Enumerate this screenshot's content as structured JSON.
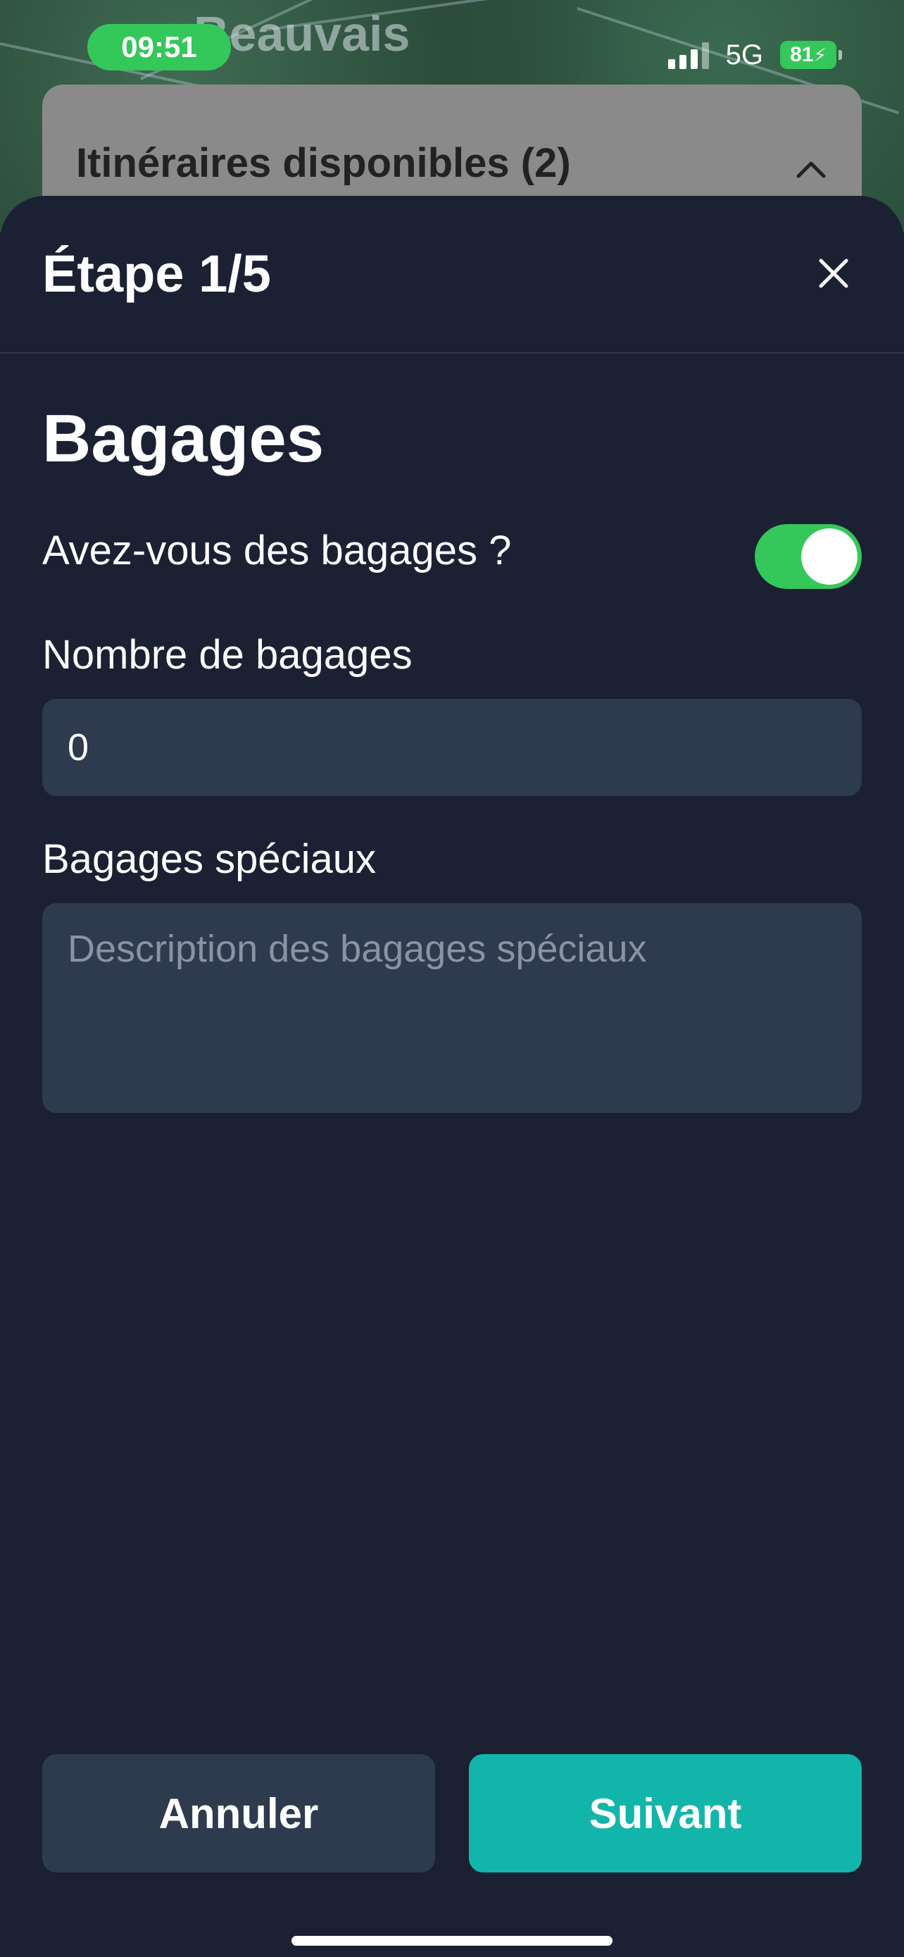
{
  "status_bar": {
    "time": "09:51",
    "network": "5G",
    "battery": "81"
  },
  "map": {
    "place_label": "Beauvais"
  },
  "itineraries_card": {
    "title": "Itinéraires disponibles (2)",
    "chevron_icon": "chevron-up-icon"
  },
  "sheet": {
    "step_title": "Étape 1/5",
    "close_icon": "close-icon",
    "section_title": "Bagages",
    "has_luggage_label": "Avez-vous des bagages ?",
    "has_luggage_toggle_on": true,
    "count_label": "Nombre de bagages",
    "count_value": "0",
    "special_label": "Bagages spéciaux",
    "special_placeholder": "Description des bagages spéciaux",
    "special_value": ""
  },
  "actions": {
    "cancel_label": "Annuler",
    "next_label": "Suivant"
  },
  "colors": {
    "background": "#1b2033",
    "input_bg": "#2e3a4d",
    "accent": "#12b5aa",
    "toggle_on": "#34c759"
  }
}
